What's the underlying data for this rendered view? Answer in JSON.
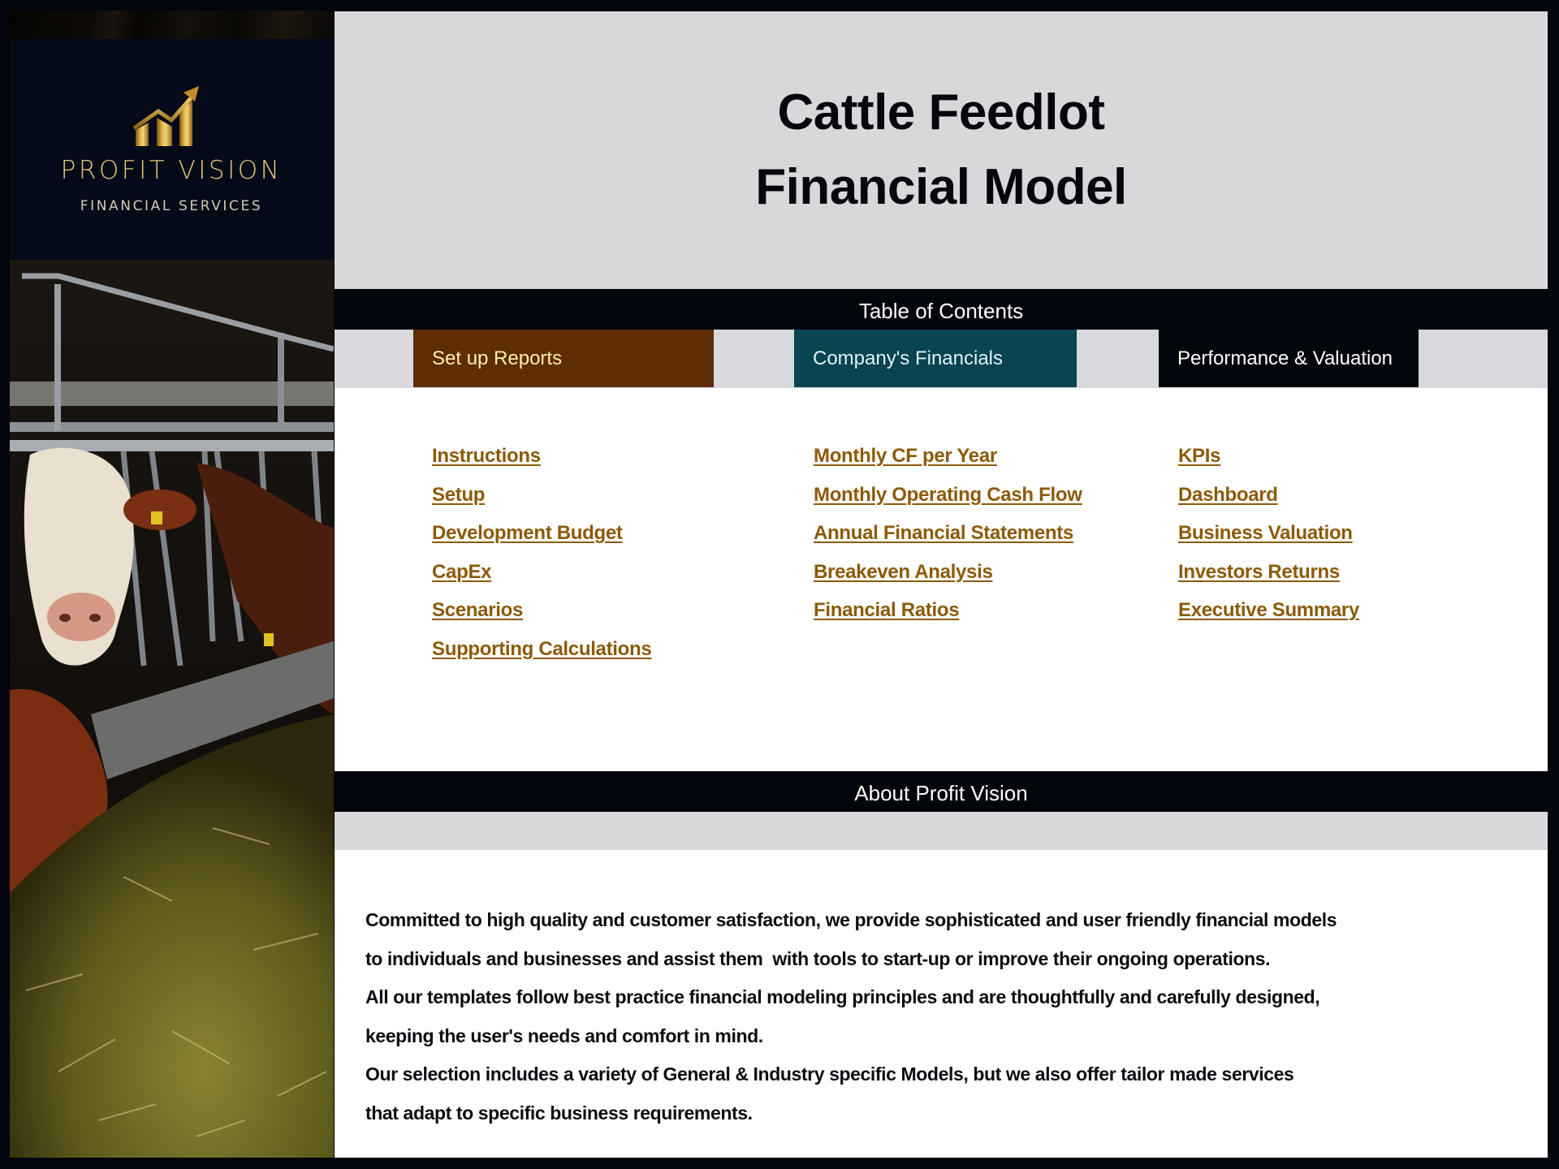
{
  "brand": {
    "name": "PROFIT VISION",
    "tagline": "FINANCIAL SERVICES",
    "logo_icon": "rising-bar-chart-arrow-icon",
    "gold": "#e2c778"
  },
  "hero": {
    "photo": "cattle-at-feed-bunk-photo",
    "title_line1": "Cattle Feedlot",
    "title_line2": "Financial Model"
  },
  "toc": {
    "heading": "Table of Contents",
    "columns": [
      {
        "tab_label": "Set up Reports",
        "tab_color": "#5e2c05",
        "links": [
          "Instructions",
          "Setup",
          "Development Budget",
          "CapEx",
          "Scenarios",
          "Supporting Calculations"
        ]
      },
      {
        "tab_label": "Company's Financials",
        "tab_color": "#0a4351",
        "links": [
          "Monthly CF per Year",
          "Monthly Operating Cash Flow",
          "Annual Financial Statements",
          "Breakeven Analysis",
          "Financial Ratios"
        ]
      },
      {
        "tab_label": "Performance & Valuation",
        "tab_color": "#03050d",
        "links": [
          "KPIs",
          "Dashboard",
          "Business Valuation",
          "Investors Returns",
          "Executive Summary"
        ]
      }
    ],
    "link_color": "#8c5a08"
  },
  "about": {
    "heading": "About Profit Vision",
    "lines": [
      "Committed to high quality and customer satisfaction, we provide sophisticated and user friendly financial models",
      "to individuals and businesses and assist them  with tools to start-up or improve their ongoing operations.",
      "All our templates follow best practice financial modeling principles and are thoughtfully and carefully designed,",
      "keeping the user's needs and comfort in mind.",
      "Our selection includes a variety of General & Industry specific Models, but we also offer tailor made services",
      "that adapt to specific business requirements."
    ]
  }
}
